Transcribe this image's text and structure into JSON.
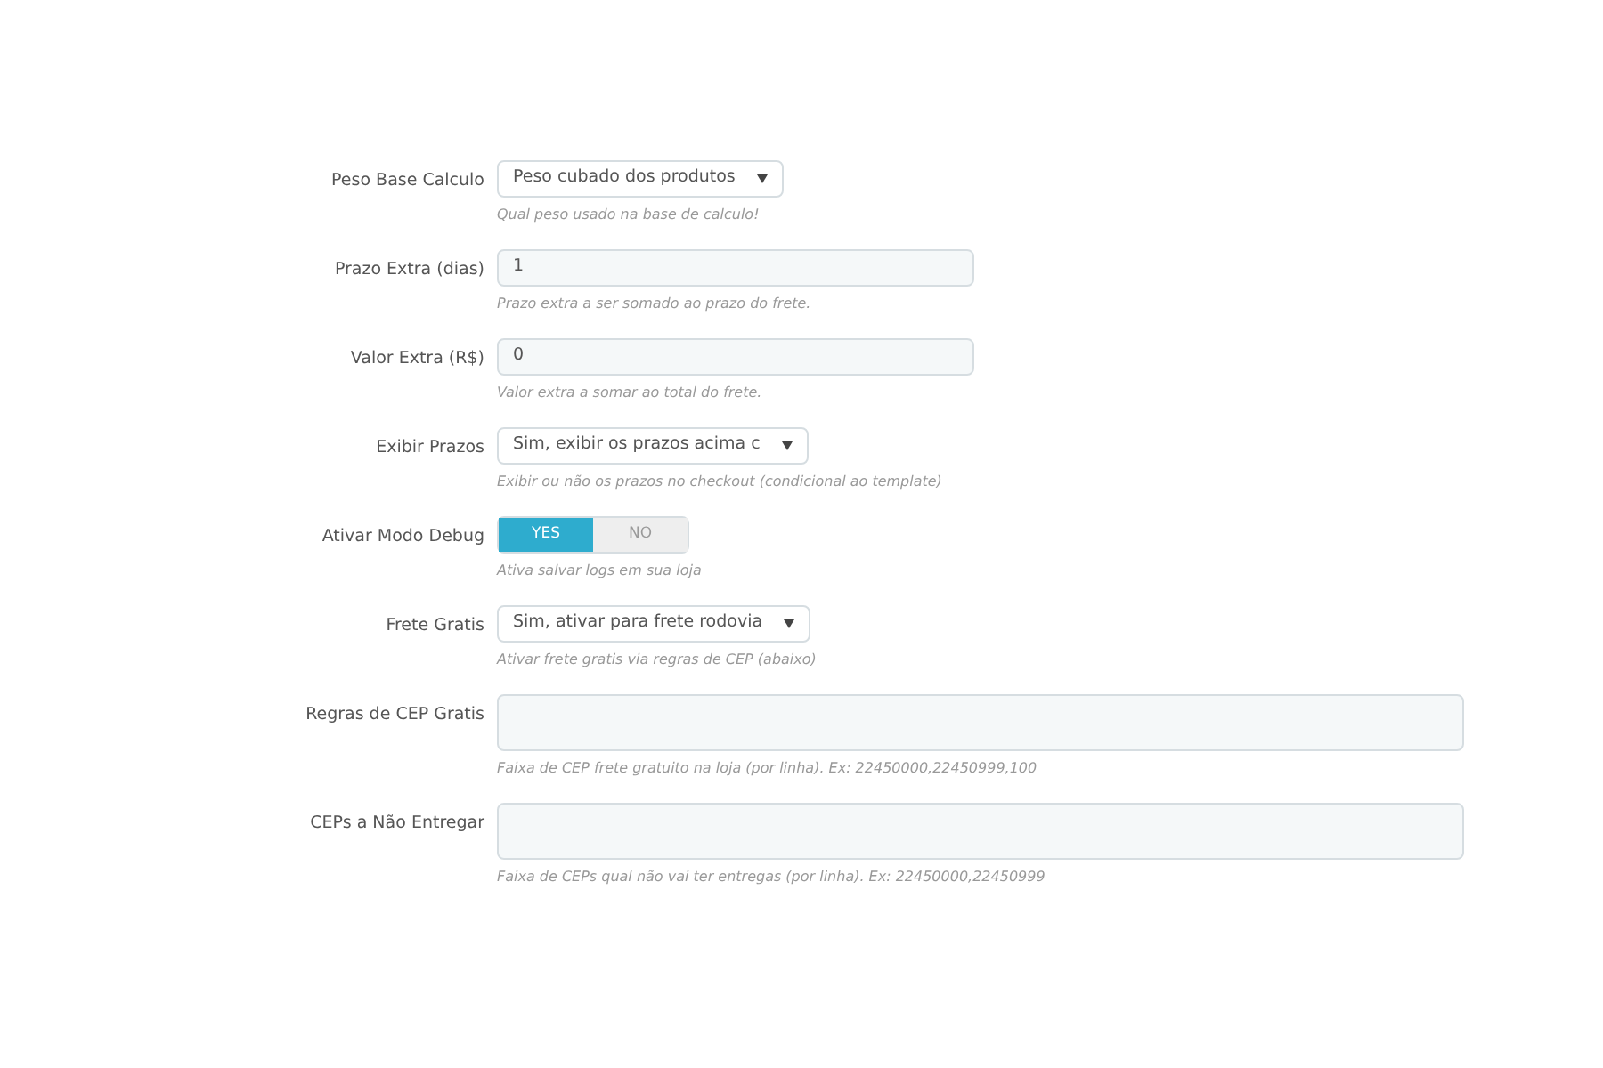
{
  "fields": [
    {
      "kind": "select",
      "label": "Peso Base Calculo",
      "value": "Peso cubado dos produtos",
      "help": "Qual peso usado na base de calculo!"
    },
    {
      "kind": "text",
      "label": "Prazo Extra (dias)",
      "value": "1",
      "help": "Prazo extra a ser somado ao prazo do frete."
    },
    {
      "kind": "text",
      "label": "Valor Extra (R$)",
      "value": "0",
      "help": "Valor extra a somar ao total do frete."
    },
    {
      "kind": "select",
      "label": "Exibir Prazos",
      "value": "Sim, exibir os prazos acima c",
      "help": "Exibir ou não os prazos no checkout (condicional ao template)"
    },
    {
      "kind": "toggle",
      "label": "Ativar Modo Debug",
      "options": [
        {
          "label": "YES",
          "selected": true
        },
        {
          "label": "NO",
          "selected": false
        }
      ],
      "help": "Ativa salvar logs em sua loja"
    },
    {
      "kind": "select",
      "label": "Frete Gratis",
      "value": "Sim, ativar para frete rodovia",
      "help": "Ativar frete gratis via regras de CEP (abaixo)"
    },
    {
      "kind": "textarea",
      "label": "Regras de CEP Gratis",
      "help": "Faixa de CEP frete gratuito na loja (por linha). Ex: 22450000,22450999,100"
    },
    {
      "kind": "textarea",
      "label": "CEPs a Não Entregar",
      "help": "Faixa de CEPs qual não vai ter entregas (por linha). Ex: 22450000,22450999"
    }
  ]
}
